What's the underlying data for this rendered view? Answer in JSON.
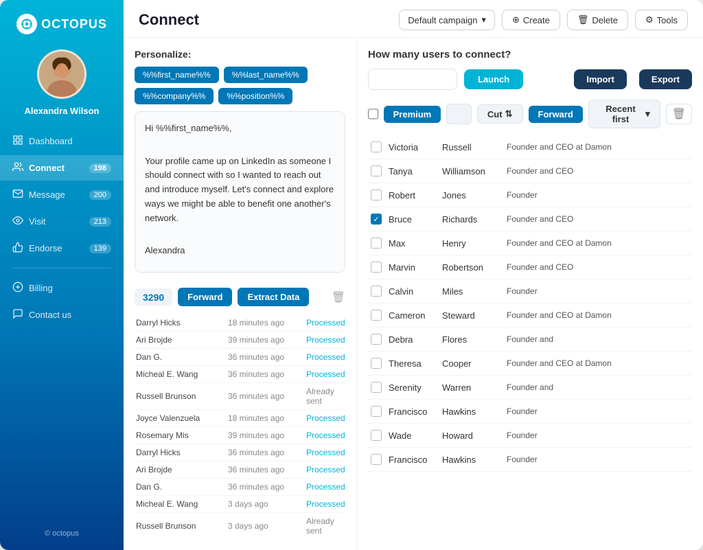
{
  "sidebar": {
    "logo_text": "OCTOPUS",
    "user_name": "Alexandra Wilson",
    "copyright": "© octopus",
    "nav_items": [
      {
        "id": "dashboard",
        "label": "Dashboard",
        "badge": null,
        "active": false,
        "icon": "dashboard-icon"
      },
      {
        "id": "connect",
        "label": "Connect",
        "badge": "198",
        "active": true,
        "icon": "connect-icon"
      },
      {
        "id": "message",
        "label": "Message",
        "badge": "200",
        "active": false,
        "icon": "message-icon"
      },
      {
        "id": "visit",
        "label": "Visit",
        "badge": "213",
        "active": false,
        "icon": "visit-icon"
      },
      {
        "id": "endorse",
        "label": "Endorse",
        "badge": "139",
        "active": false,
        "icon": "endorse-icon"
      }
    ],
    "bottom_nav": [
      {
        "id": "billing",
        "label": "Billing",
        "icon": "billing-icon"
      },
      {
        "id": "contact",
        "label": "Contact us",
        "icon": "contact-icon"
      }
    ]
  },
  "topbar": {
    "page_title": "Connect",
    "campaign_label": "Default campaign",
    "create_label": "Create",
    "delete_label": "Delete",
    "tools_label": "Tools"
  },
  "left_panel": {
    "personalize_label": "Personalize:",
    "tags": [
      "%%first_name%%",
      "%%last_name%%",
      "%%company%%",
      "%%position%%"
    ],
    "message_lines": [
      "Hi %%first_name%%,",
      "",
      "Your profile came up on LinkedIn as someone I should connect with so I wanted to reach out and introduce myself. Let's connect and explore ways we might be able to benefit one another's network.",
      "",
      "Alexandra"
    ],
    "count": "3290",
    "forward_label": "Forward",
    "extract_label": "Extract Data",
    "activity": [
      {
        "name": "Darryl Hicks",
        "time": "18 minutes ago",
        "status": "Processed",
        "type": "processed"
      },
      {
        "name": "Ari Brojde",
        "time": "39 minutes ago",
        "status": "Processed",
        "type": "processed"
      },
      {
        "name": "Dan G.",
        "time": "36 minutes ago",
        "status": "Processed",
        "type": "processed"
      },
      {
        "name": "Micheal E. Wang",
        "time": "36 minutes ago",
        "status": "Processed",
        "type": "processed"
      },
      {
        "name": "Russell Brunson",
        "time": "36 minutes ago",
        "status": "Already sent",
        "type": "sent"
      },
      {
        "name": "Joyce Valenzuela",
        "time": "18 minutes ago",
        "status": "Processed",
        "type": "processed"
      },
      {
        "name": "Rosemary Mis",
        "time": "39 minutes ago",
        "status": "Processed",
        "type": "processed"
      },
      {
        "name": "Darryl Hicks",
        "time": "36 minutes ago",
        "status": "Processed",
        "type": "processed"
      },
      {
        "name": "Ari Brojde",
        "time": "36 minutes ago",
        "status": "Processed",
        "type": "processed"
      },
      {
        "name": "Dan G.",
        "time": "36 minutes ago",
        "status": "Processed",
        "type": "processed"
      },
      {
        "name": "Micheal E. Wang",
        "time": "3 days ago",
        "status": "Processed",
        "type": "processed"
      },
      {
        "name": "Russell Brunson",
        "time": "3 days ago",
        "status": "Already sent",
        "type": "sent"
      }
    ]
  },
  "right_panel": {
    "connect_header": "How many users to connect?",
    "launch_placeholder": "",
    "launch_label": "Launch",
    "import_label": "Import",
    "export_label": "Export",
    "filter_buttons": {
      "premium": "Premium",
      "cut": "Cut",
      "forward": "Forward",
      "recent": "Recent first"
    },
    "users": [
      {
        "first": "Victoria",
        "last": "Russell",
        "position": "Founder and CEO at Damon",
        "checked": false
      },
      {
        "first": "Tanya",
        "last": "Williamson",
        "position": "Founder and CEO",
        "checked": false
      },
      {
        "first": "Robert",
        "last": "Jones",
        "position": "Founder",
        "checked": false
      },
      {
        "first": "Bruce",
        "last": "Richards",
        "position": "Founder and CEO",
        "checked": true
      },
      {
        "first": "Max",
        "last": "Henry",
        "position": "Founder and CEO at Damon",
        "checked": false
      },
      {
        "first": "Marvin",
        "last": "Robertson",
        "position": "Founder and CEO",
        "checked": false
      },
      {
        "first": "Calvin",
        "last": "Miles",
        "position": "Founder",
        "checked": false
      },
      {
        "first": "Cameron",
        "last": "Steward",
        "position": "Founder and CEO at Damon",
        "checked": false
      },
      {
        "first": "Debra",
        "last": "Flores",
        "position": "Founder and",
        "checked": false
      },
      {
        "first": "Theresa",
        "last": "Cooper",
        "position": "Founder and CEO at Damon",
        "checked": false
      },
      {
        "first": "Serenity",
        "last": "Warren",
        "position": "Founder and",
        "checked": false
      },
      {
        "first": "Francisco",
        "last": "Hawkins",
        "position": "Founder",
        "checked": false
      },
      {
        "first": "Wade",
        "last": "Howard",
        "position": "Founder",
        "checked": false
      },
      {
        "first": "Francisco",
        "last": "Hawkins",
        "position": "Founder",
        "checked": false
      }
    ]
  }
}
